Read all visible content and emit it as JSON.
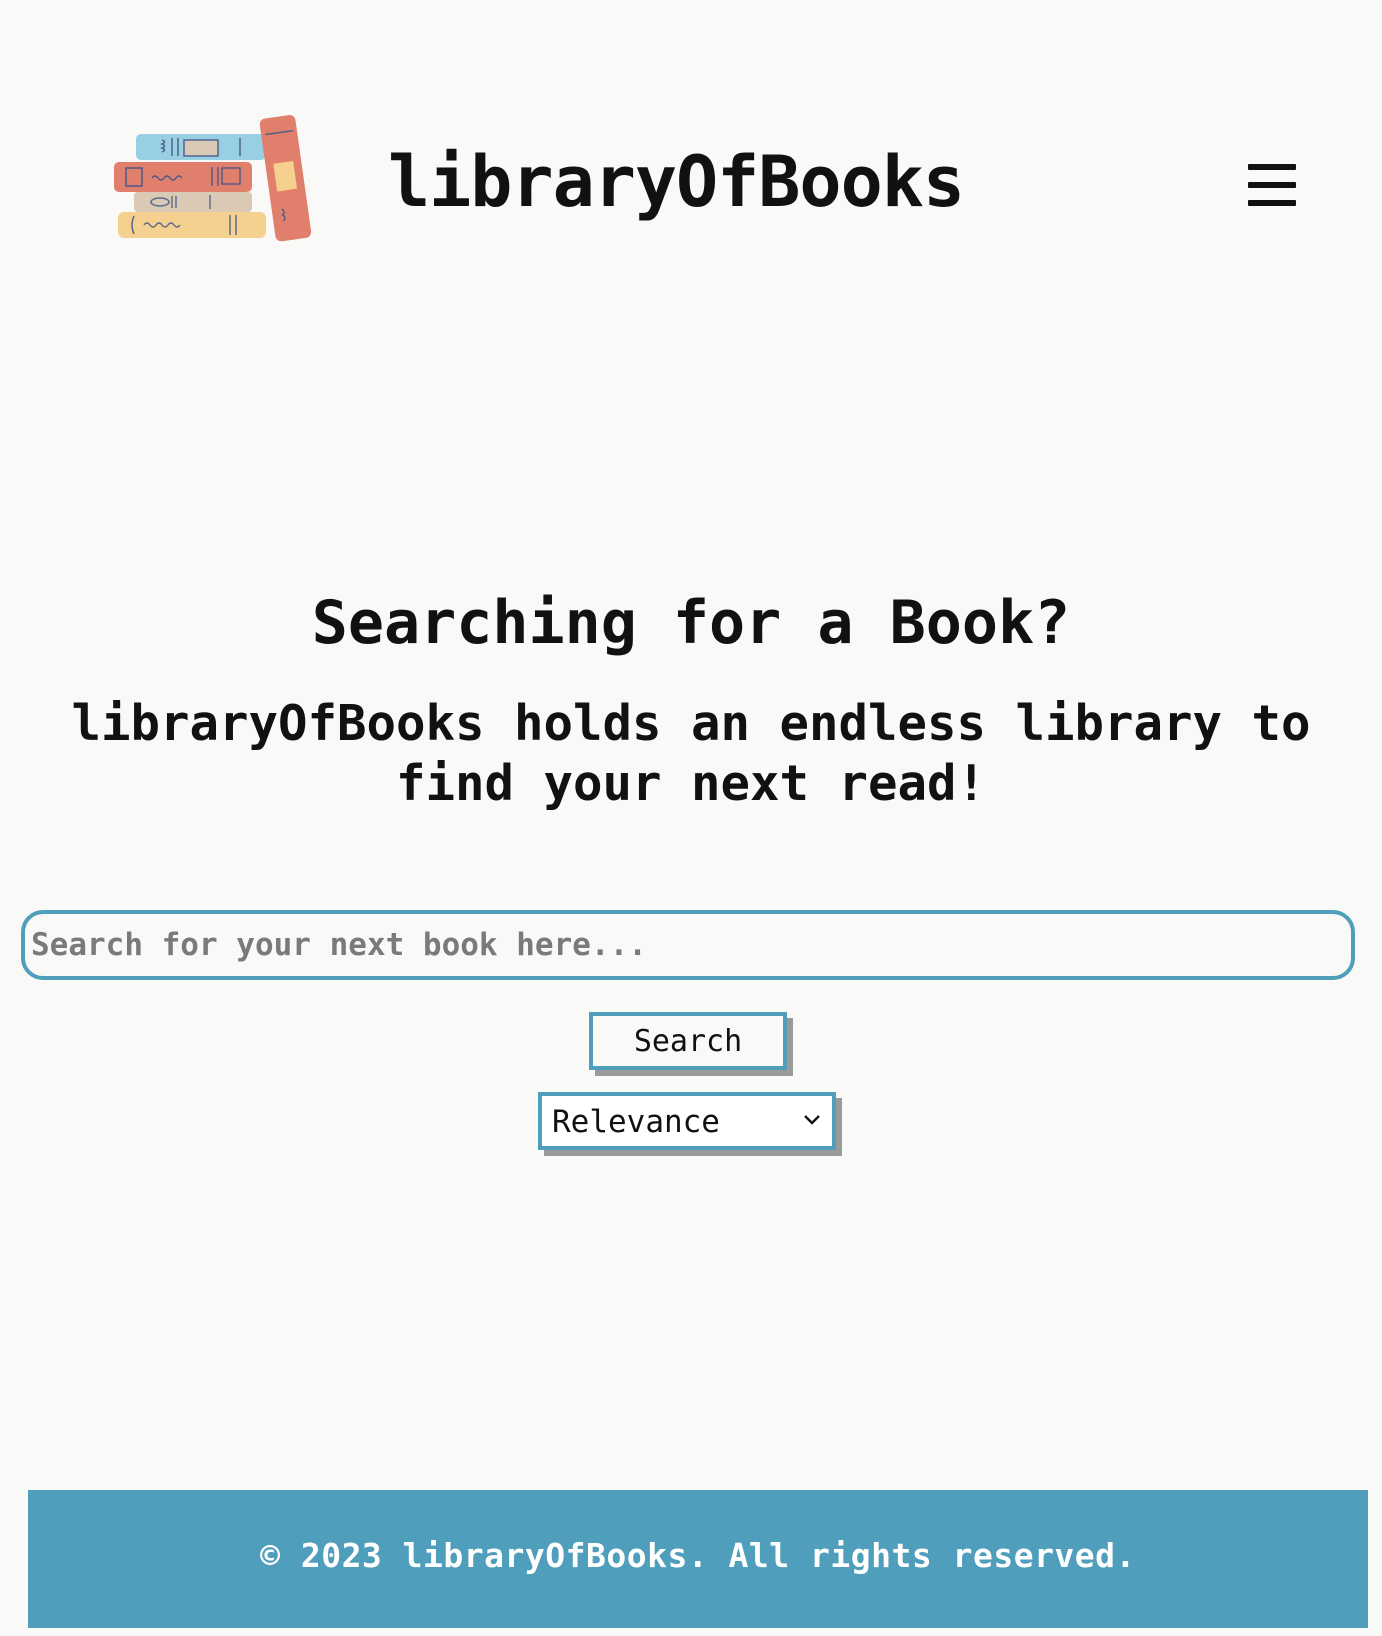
{
  "header": {
    "site_title": "libraryOfBooks",
    "logo_icon": "stacked-books-logo",
    "menu_icon": "hamburger-menu-icon"
  },
  "hero": {
    "title": "Searching for a Book?",
    "subtitle": "libraryOfBooks holds an endless library to find your next read!"
  },
  "search": {
    "value": "",
    "placeholder": "Search for your next book here...",
    "button_label": "Search"
  },
  "sort": {
    "selected": "Relevance"
  },
  "footer": {
    "text": "© 2023 libraryOfBooks. All rights reserved."
  },
  "colors": {
    "accent": "#4f9ebb",
    "background": "#f9f9f7",
    "text": "#111111",
    "shadow": "#9a9a9a",
    "footer_text": "#ffffff"
  }
}
